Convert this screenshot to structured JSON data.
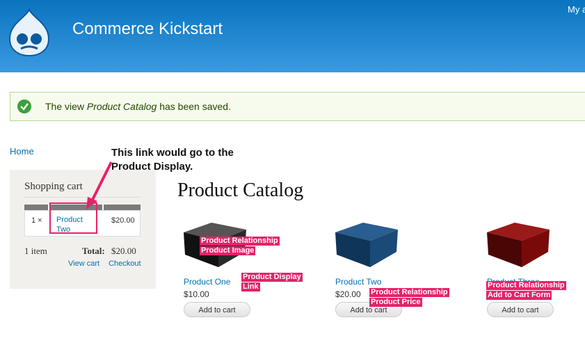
{
  "header": {
    "site_name": "Commerce Kickstart",
    "my_account": "My a"
  },
  "messages": {
    "text_prefix": "The view ",
    "text_italic": "Product Catalog",
    "text_suffix": " has been saved."
  },
  "breadcrumb": {
    "home": "Home"
  },
  "annotation": {
    "line1": "This link would go to the",
    "line2": "Product Display."
  },
  "cart": {
    "title": "Shopping cart",
    "row": {
      "qty": "1 ×",
      "product_line1": "Product",
      "product_line2": "Two",
      "price": "$20.00"
    },
    "item_count": "1 item",
    "total_label": "Total:",
    "total_value": "$20.00",
    "view_cart": "View cart",
    "checkout": "Checkout"
  },
  "main": {
    "title": "Product Catalog",
    "products": [
      {
        "name": "Product One",
        "price": "$10.00",
        "button": "Add to cart",
        "color": "#2a2a2a"
      },
      {
        "name": "Product Two",
        "price": "$20.00",
        "button": "Add to cart",
        "color": "#1a4a78"
      },
      {
        "name": "Product Three",
        "price": "",
        "button": "Add to cart",
        "color": "#7a0a0a"
      }
    ]
  },
  "callouts": {
    "relationship_image_1": "Product Relationship",
    "relationship_image_2": "Product Image",
    "display_link_1": "Product Display",
    "display_link_2": "Link",
    "relationship_price_1": "Product Relationship",
    "relationship_price_2": "Product Price",
    "relationship_cart_1": "Product Relationship",
    "relationship_cart_2": "Add to Cart Form"
  },
  "colors": {
    "header_blue": "#0a74c0",
    "link_blue": "#0071b3",
    "callout_pink": "#e6226a",
    "message_green": "#3ba03b"
  }
}
